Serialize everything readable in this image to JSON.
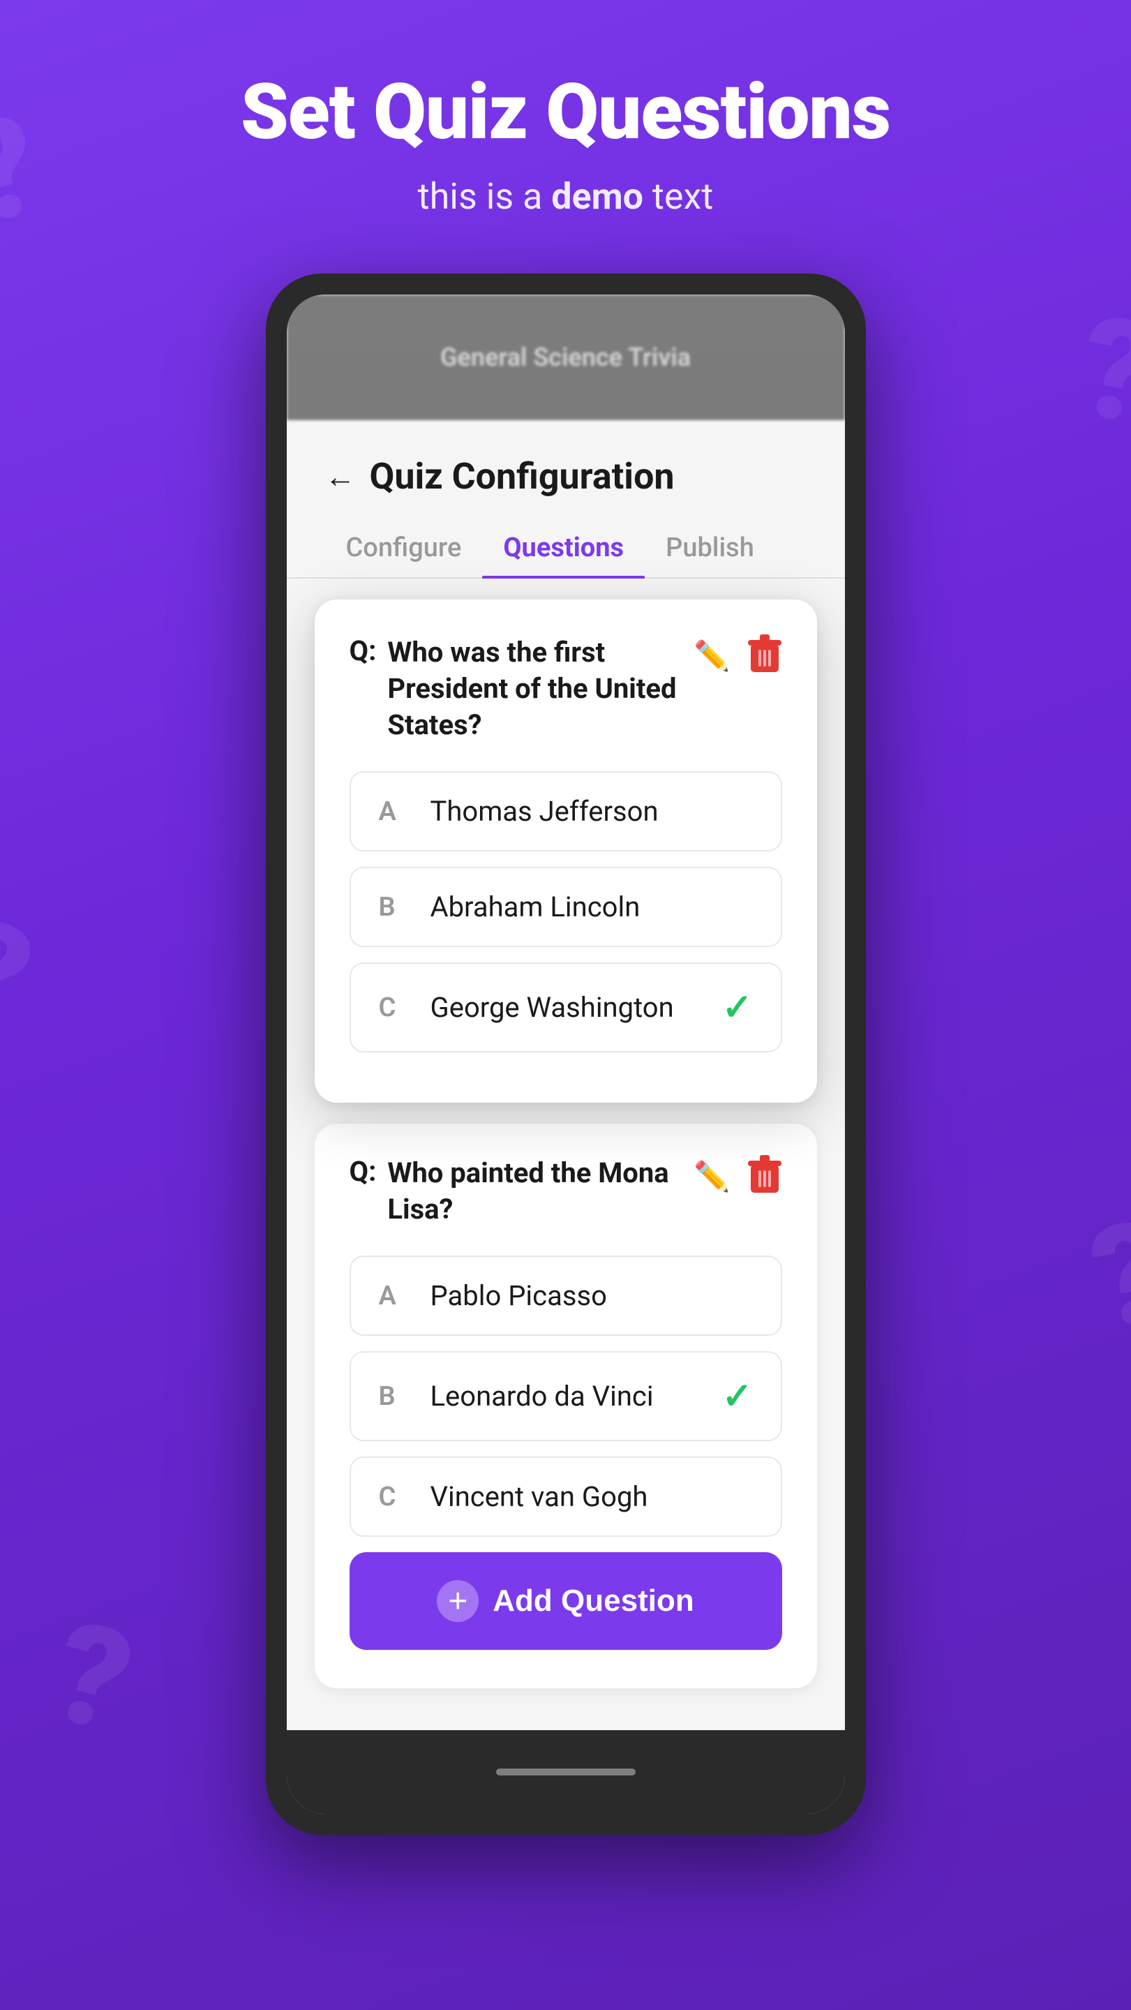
{
  "hero": {
    "title": "Set Quiz Questions",
    "subtitle_start": "this is a ",
    "subtitle_bold": "demo",
    "subtitle_end": " text"
  },
  "phone": {
    "blur_text": "General Science Trivia"
  },
  "config": {
    "back_label": "←",
    "title": "Quiz Configuration",
    "tabs": [
      {
        "label": "Configure",
        "active": false
      },
      {
        "label": "Questions",
        "active": true
      },
      {
        "label": "Publish",
        "active": false
      }
    ]
  },
  "questions": [
    {
      "id": "q1",
      "q_label": "Q:",
      "text": "Who was the first President of the United States?",
      "answers": [
        {
          "letter": "A",
          "text": "Thomas Jefferson",
          "correct": false
        },
        {
          "letter": "B",
          "text": "Abraham Lincoln",
          "correct": false
        },
        {
          "letter": "C",
          "text": "George Washington",
          "correct": true
        }
      ],
      "elevated": true
    },
    {
      "id": "q2",
      "q_label": "Q:",
      "text": "Who painted the Mona Lisa?",
      "answers": [
        {
          "letter": "A",
          "text": "Pablo Picasso",
          "correct": false
        },
        {
          "letter": "B",
          "text": "Leonardo da Vinci",
          "correct": true
        },
        {
          "letter": "C",
          "text": "Vincent van Gogh",
          "correct": false
        }
      ],
      "elevated": false
    }
  ],
  "add_button": {
    "label": "Add Question",
    "icon": "+"
  }
}
